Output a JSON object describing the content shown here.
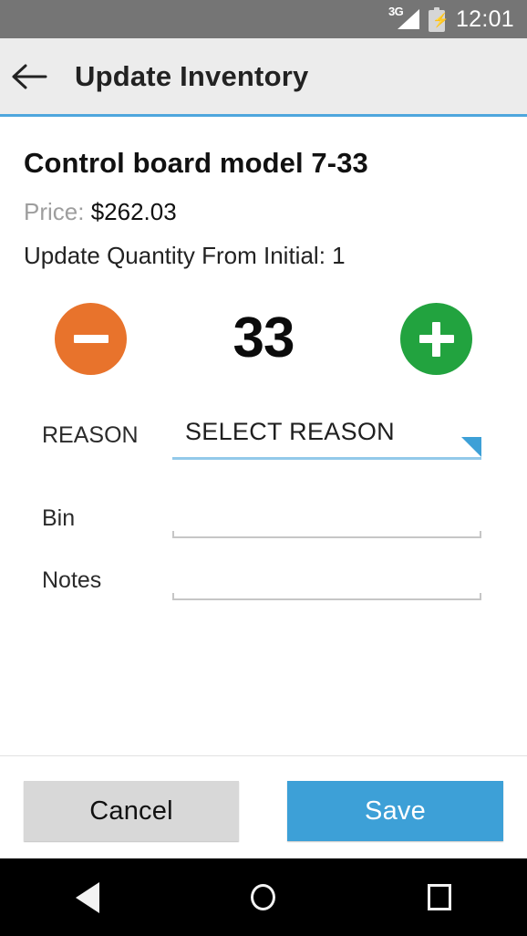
{
  "status_bar": {
    "network": "3G",
    "battery_icon": "battery-charging-icon",
    "time": "12:01",
    "background": "#757575"
  },
  "app_bar": {
    "back_icon": "arrow-left-icon",
    "title": "Update Inventory",
    "background": "#ececec",
    "accent_color": "#4ea6dd"
  },
  "item": {
    "name": "Control board model 7-33",
    "price_label": "Price:",
    "price_value": "$262.03",
    "quantity_from_initial": "Update Quantity From Initial: 1"
  },
  "stepper": {
    "decrement_icon": "minus-circle-icon",
    "decrement_color": "#e8732c",
    "quantity": "33",
    "increment_icon": "plus-circle-icon",
    "increment_color": "#22a33f"
  },
  "form": {
    "fields": [
      {
        "label": "REASON",
        "type": "spinner",
        "value": "SELECT REASON",
        "dropdown_icon": "dropdown-triangle-icon",
        "underline_color": "#93c9ea"
      },
      {
        "label": "Bin",
        "type": "text",
        "value": "",
        "placeholder": "",
        "underline_color": "#c6c6c6"
      },
      {
        "label": "Notes",
        "type": "text",
        "value": "",
        "placeholder": "",
        "underline_color": "#c6c6c6"
      }
    ]
  },
  "footer": {
    "cancel_label": "Cancel",
    "cancel_color": "#d8d8d8",
    "save_label": "Save",
    "save_color": "#3da0d7"
  },
  "nav_bar": {
    "back_icon": "nav-back-triangle-icon",
    "home_icon": "nav-home-circle-icon",
    "recents_icon": "nav-recents-square-icon",
    "background": "#000000"
  }
}
